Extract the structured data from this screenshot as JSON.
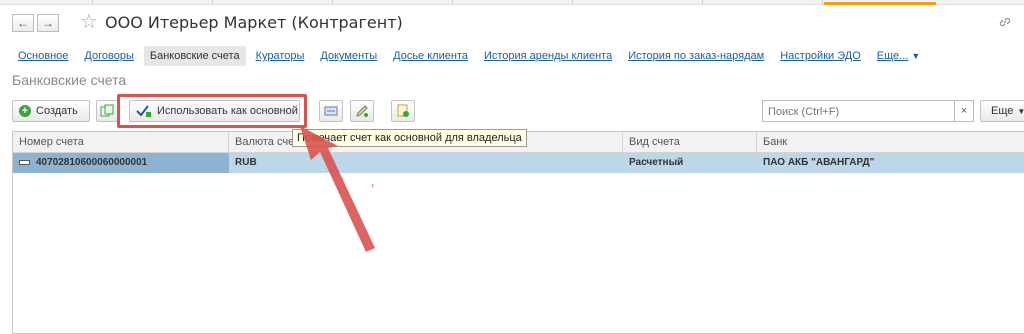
{
  "window": {
    "title": "ООО Итерьер Маркет (Контрагент)",
    "nav_back": "←",
    "nav_forward": "→",
    "link_glyph": "🔗"
  },
  "tabs": [
    {
      "label": "Основное"
    },
    {
      "label": "Договоры"
    },
    {
      "label": "Банковские счета"
    },
    {
      "label": "Кураторы"
    },
    {
      "label": "Документы"
    },
    {
      "label": "Досье клиента"
    },
    {
      "label": "История аренды клиента"
    },
    {
      "label": "История по заказ-нарядам"
    },
    {
      "label": "Настройки ЭДО"
    },
    {
      "label": "Еще..."
    }
  ],
  "section_title": "Банковские счета",
  "toolbar": {
    "create_label": "Создать",
    "use_main_label": "Использовать как основной",
    "search_placeholder": "Поиск (Ctrl+F)",
    "search_clear": "×",
    "more_label": "Еще"
  },
  "table": {
    "columns": [
      "Номер счета",
      "Валюта счета",
      "Вид счета",
      "Банк"
    ],
    "rows": [
      {
        "number": "40702810600060000001",
        "currency": "RUB",
        "kind": "Расчетный",
        "bank": "ПАО АКБ \"АВАНГАРД\""
      }
    ]
  },
  "tooltip": "Помечает счет как основной для владельца",
  "colors": {
    "accent_tab": "#f39c12",
    "link": "#1a5fa8",
    "annotation_red": "#d9534f",
    "selected_row": "#bcd6ea"
  }
}
